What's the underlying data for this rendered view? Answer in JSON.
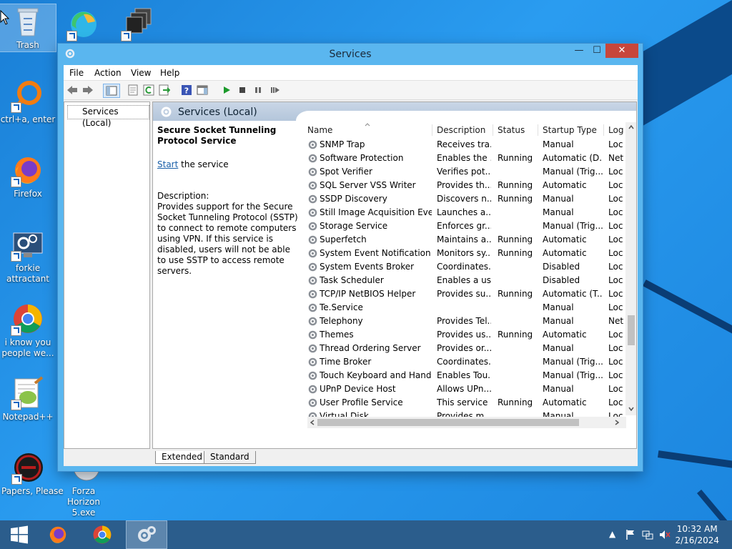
{
  "desktop": {
    "icons": [
      {
        "label": "Trash",
        "selected": true,
        "icon": "recycle-bin-icon"
      },
      {
        "label": "",
        "icon": "edge-icon"
      },
      {
        "label": "",
        "icon": "windows-stack-icon"
      },
      {
        "label": "ctrl+a, enter",
        "icon": "orange-ring-icon"
      },
      {
        "label": "Firefox",
        "icon": "firefox-icon"
      },
      {
        "label": "forkie attractant",
        "icon": "settings-monitor-icon"
      },
      {
        "label": "i know you people we...",
        "icon": "chrome-icon"
      },
      {
        "label": "Notepad++",
        "icon": "notepadpp-icon"
      },
      {
        "label": "Papers, Please",
        "icon": "papers-please-icon"
      },
      {
        "label": "Forza Horizon 5.exe",
        "icon": "forza-icon"
      }
    ]
  },
  "window": {
    "title": "Services",
    "minimize_label": "—",
    "maximize_label": "☐",
    "close_label": "✕",
    "menu": [
      "File",
      "Action",
      "View",
      "Help"
    ],
    "tree_item": "Services (Local)",
    "main_header": "Services (Local)",
    "detail": {
      "name": "Secure Socket Tunneling Protocol Service",
      "start_link": "Start",
      "start_suffix": " the service",
      "description_label": "Description:",
      "description": "Provides support for the Secure Socket Tunneling Protocol (SSTP) to connect to remote computers using VPN. If this service is disabled, users will not be able to use SSTP to access remote servers."
    },
    "columns": [
      "Name",
      "Description",
      "Status",
      "Startup Type",
      "Log"
    ],
    "rows": [
      {
        "name": "SNMP Trap",
        "desc": "Receives tra...",
        "status": "",
        "startup": "Manual",
        "log": "Loc"
      },
      {
        "name": "Software Protection",
        "desc": "Enables the ...",
        "status": "Running",
        "startup": "Automatic (D...",
        "log": "Net"
      },
      {
        "name": "Spot Verifier",
        "desc": "Verifies pot...",
        "status": "",
        "startup": "Manual (Trig...",
        "log": "Loc"
      },
      {
        "name": "SQL Server VSS Writer",
        "desc": "Provides th...",
        "status": "Running",
        "startup": "Automatic",
        "log": "Loc"
      },
      {
        "name": "SSDP Discovery",
        "desc": "Discovers n...",
        "status": "Running",
        "startup": "Manual",
        "log": "Loc"
      },
      {
        "name": "Still Image Acquisition Events",
        "desc": "Launches a...",
        "status": "",
        "startup": "Manual",
        "log": "Loc"
      },
      {
        "name": "Storage Service",
        "desc": "Enforces gr...",
        "status": "",
        "startup": "Manual (Trig...",
        "log": "Loc"
      },
      {
        "name": "Superfetch",
        "desc": "Maintains a...",
        "status": "Running",
        "startup": "Automatic",
        "log": "Loc"
      },
      {
        "name": "System Event Notification S...",
        "desc": "Monitors sy...",
        "status": "Running",
        "startup": "Automatic",
        "log": "Loc"
      },
      {
        "name": "System Events Broker",
        "desc": "Coordinates...",
        "status": "",
        "startup": "Disabled",
        "log": "Loc"
      },
      {
        "name": "Task Scheduler",
        "desc": "Enables a us...",
        "status": "",
        "startup": "Disabled",
        "log": "Loc"
      },
      {
        "name": "TCP/IP NetBIOS Helper",
        "desc": "Provides su...",
        "status": "Running",
        "startup": "Automatic (T...",
        "log": "Loc"
      },
      {
        "name": "Te.Service",
        "desc": "",
        "status": "",
        "startup": "Manual",
        "log": "Loc"
      },
      {
        "name": "Telephony",
        "desc": "Provides Tel...",
        "status": "",
        "startup": "Manual",
        "log": "Net"
      },
      {
        "name": "Themes",
        "desc": "Provides us...",
        "status": "Running",
        "startup": "Automatic",
        "log": "Loc"
      },
      {
        "name": "Thread Ordering Server",
        "desc": "Provides or...",
        "status": "",
        "startup": "Manual",
        "log": "Loc"
      },
      {
        "name": "Time Broker",
        "desc": "Coordinates...",
        "status": "",
        "startup": "Manual (Trig...",
        "log": "Loc"
      },
      {
        "name": "Touch Keyboard and Hand...",
        "desc": "Enables Tou...",
        "status": "",
        "startup": "Manual (Trig...",
        "log": "Loc"
      },
      {
        "name": "UPnP Device Host",
        "desc": "Allows UPn...",
        "status": "",
        "startup": "Manual",
        "log": "Loc"
      },
      {
        "name": "User Profile Service",
        "desc": "This service ...",
        "status": "Running",
        "startup": "Automatic",
        "log": "Loc"
      },
      {
        "name": "Virtual Disk",
        "desc": "Provides m...",
        "status": "",
        "startup": "Manual",
        "log": "Loc"
      }
    ],
    "tabs": [
      "Extended",
      "Standard"
    ]
  },
  "taskbar": {
    "time": "10:32 AM",
    "date": "2/16/2024"
  },
  "colors": {
    "accent": "#2b5d8c",
    "window_frame": "#5ab6ef",
    "close": "#c7463b",
    "link": "#1a5fa8"
  }
}
